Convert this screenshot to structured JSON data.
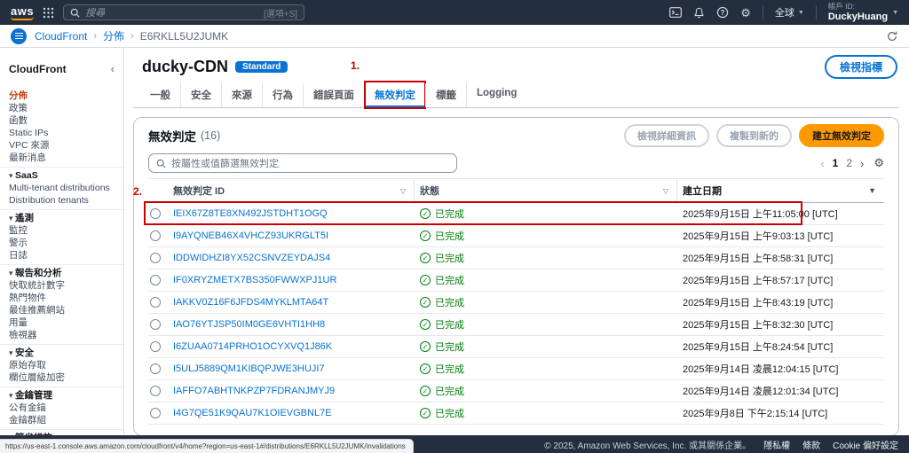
{
  "colors": {
    "topbar_bg": "#232f3e",
    "accent_orange": "#ff9900",
    "link_blue": "#0972d3",
    "status_green": "#037f0c",
    "active_nav": "#c1440e",
    "annotation_red": "#cc0000"
  },
  "topbar": {
    "logo": "aws",
    "search_placeholder": "搜尋",
    "search_shortcut": "[選項+S]",
    "region": "全球",
    "account_label": "帳戶 ID:",
    "user_name": "DuckyHuang"
  },
  "breadcrumb": {
    "separator": "›",
    "items": [
      {
        "label": "CloudFront",
        "kind": "link"
      },
      {
        "label": "分佈",
        "kind": "link"
      },
      {
        "label": "E6RKLL5U2JUMK",
        "kind": "current"
      }
    ]
  },
  "sidebar": {
    "title": "CloudFront",
    "collapse_icon": "‹",
    "items": [
      {
        "label": "分佈",
        "kind": "top",
        "active": true
      },
      {
        "label": "政策",
        "kind": "top"
      },
      {
        "label": "函數",
        "kind": "top"
      },
      {
        "label": "Static IPs",
        "kind": "top"
      },
      {
        "label": "VPC 來源",
        "kind": "top"
      },
      {
        "label": "最新消息",
        "kind": "top"
      },
      {
        "label": "SaaS",
        "kind": "section"
      },
      {
        "label": "Multi-tenant distributions",
        "kind": "top"
      },
      {
        "label": "Distribution tenants",
        "kind": "top"
      },
      {
        "label": "遙測",
        "kind": "section"
      },
      {
        "label": "監控",
        "kind": "top"
      },
      {
        "label": "警示",
        "kind": "top"
      },
      {
        "label": "日誌",
        "kind": "top"
      },
      {
        "label": "報告和分析",
        "kind": "section"
      },
      {
        "label": "快取統計數字",
        "kind": "top"
      },
      {
        "label": "熱門物件",
        "kind": "top"
      },
      {
        "label": "最佳推薦網站",
        "kind": "top"
      },
      {
        "label": "用量",
        "kind": "top"
      },
      {
        "label": "檢視器",
        "kind": "top"
      },
      {
        "label": "安全",
        "kind": "section"
      },
      {
        "label": "原始存取",
        "kind": "top"
      },
      {
        "label": "欄位層級加密",
        "kind": "top"
      },
      {
        "label": "金鑰管理",
        "kind": "section"
      },
      {
        "label": "公有金鑰",
        "kind": "top"
      },
      {
        "label": "金鑰群組",
        "kind": "top"
      },
      {
        "label": "節省措施",
        "kind": "section"
      }
    ]
  },
  "main": {
    "title": "ducky-CDN",
    "badge": "Standard",
    "view_metrics": "檢視指標",
    "tabs": [
      {
        "label": "一般"
      },
      {
        "label": "安全"
      },
      {
        "label": "來源"
      },
      {
        "label": "行為"
      },
      {
        "label": "錯誤頁面"
      },
      {
        "label": "無效判定",
        "active": true,
        "annotation": "1."
      },
      {
        "label": "標籤"
      },
      {
        "label": "Logging"
      }
    ],
    "panel": {
      "title": "無效判定",
      "count": "(16)",
      "view_details": "檢視詳細資訊",
      "copy_to_new": "複製到新的",
      "create": "建立無效判定",
      "filter_placeholder": "按屬性或值篩選無效判定",
      "pagination": {
        "prev": "‹",
        "pages": [
          {
            "label": "1",
            "active": true
          },
          {
            "label": "2"
          }
        ],
        "next": "›"
      },
      "columns": [
        {
          "label": "無效判定 ID",
          "sort": "▽"
        },
        {
          "label": "狀態",
          "sort": "▽"
        },
        {
          "label": "建立日期",
          "sort": "▼"
        }
      ],
      "rows": [
        {
          "id": "IEIX67Z8TE8XN492JSTDHT1OGQ",
          "status": "已完成",
          "date": "2025年9月15日 上午11:05:00 [UTC]",
          "annotation": "2."
        },
        {
          "id": "I9AYQNEB46X4VHCZ93UKRGLT5I",
          "status": "已完成",
          "date": "2025年9月15日 上午9:03:13 [UTC]"
        },
        {
          "id": "IDDWIDHZI8YX52CSNVZEYDAJS4",
          "status": "已完成",
          "date": "2025年9月15日 上午8:58:31 [UTC]"
        },
        {
          "id": "IF0XRYZMETX7BS350FWWXPJ1UR",
          "status": "已完成",
          "date": "2025年9月15日 上午8:57:17 [UTC]"
        },
        {
          "id": "IAKKV0Z16F6JFDS4MYKLMTA64T",
          "status": "已完成",
          "date": "2025年9月15日 上午8:43:19 [UTC]"
        },
        {
          "id": "IAO76YTJSP50IM0GE6VHTI1HH8",
          "status": "已完成",
          "date": "2025年9月15日 上午8:32:30 [UTC]"
        },
        {
          "id": "I6ZUAA0714PRHO1OCYXVQ1J86K",
          "status": "已完成",
          "date": "2025年9月15日 上午8:24:54 [UTC]"
        },
        {
          "id": "I5ULJ5889QM1KIBQPJWE3HUJI7",
          "status": "已完成",
          "date": "2025年9月14日 凌晨12:04:15 [UTC]"
        },
        {
          "id": "IAFFO7ABHTNKPZP7FDRANJMYJ9",
          "status": "已完成",
          "date": "2025年9月14日 凌晨12:01:34 [UTC]"
        },
        {
          "id": "I4G7QE51K9QAU7K1OIEVGBNL7E",
          "status": "已完成",
          "date": "2025年9月8日 下午2:15:14 [UTC]"
        }
      ]
    }
  },
  "footer": {
    "url_tooltip": "https://us-east-1.console.aws.amazon.com/cloudfront/v4/home?region=us-east-1#/distributions/E6RKLL5U2JUMK/invalidations",
    "copyright": "© 2025, Amazon Web Services, Inc. 或其關係企業。",
    "links": [
      {
        "label": "隱私權"
      },
      {
        "label": "條款"
      },
      {
        "label": "Cookie 偏好設定"
      }
    ]
  }
}
